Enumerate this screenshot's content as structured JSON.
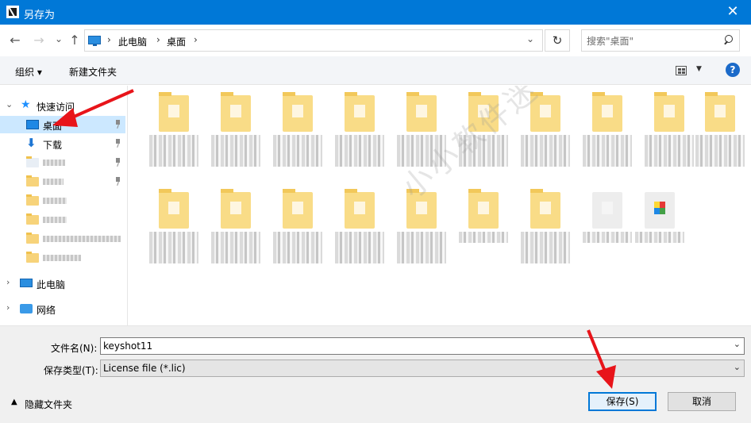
{
  "window": {
    "title": "另存为",
    "close_glyph": "✕"
  },
  "nav": {
    "back_glyph": "←",
    "forward_glyph": "→",
    "recent_glyph": "⌄",
    "up_glyph": "↑",
    "breadcrumbs": [
      "此电脑",
      "桌面"
    ],
    "crumb_sep": "›",
    "dropdown_glyph": "⌄",
    "refresh_glyph": "↻",
    "search_placeholder": "搜索\"桌面\""
  },
  "toolbar": {
    "organize_label": "组织 ▾",
    "new_folder_label": "新建文件夹",
    "view_drop_glyph": "▼",
    "help_label": "?"
  },
  "sidebar": {
    "expanded_glyph": "⌄",
    "collapsed_glyph": "›",
    "quick_access": "快速访问",
    "items": [
      {
        "label": "桌面"
      },
      {
        "label": "下载"
      },
      {
        "label": "此电脑"
      },
      {
        "label": "网络"
      }
    ],
    "star_glyph": "★",
    "down_glyph": "⬇"
  },
  "form": {
    "filename_label": "文件名(N):",
    "filename_value": "keyshot11",
    "filetype_label": "保存类型(T):",
    "filetype_value": "License file (*.lic)",
    "dropdown_glyph": "⌄",
    "hide_folders_label": "隐藏文件夹",
    "hide_caret": "▲",
    "save_label": "保存(S)",
    "cancel_label": "取消"
  },
  "watermark": "小小软件迷 www.xxrjm.com",
  "colors": {
    "title_bar": "#0078d7",
    "selection": "#cce8ff",
    "arrow": "#e8141a"
  }
}
